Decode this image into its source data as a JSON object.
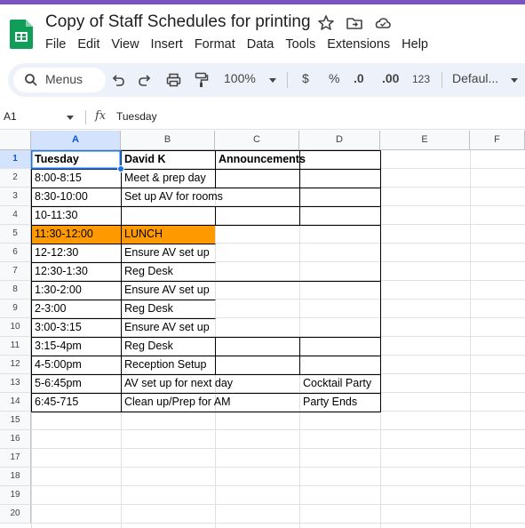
{
  "app": {
    "doc_title": "Copy of Staff Schedules for printing",
    "accent_color": "#7b53c1",
    "icons": [
      "sheets-logo",
      "star-icon",
      "move-folder-icon",
      "cloud-status-icon"
    ]
  },
  "menu": [
    "File",
    "Edit",
    "View",
    "Insert",
    "Format",
    "Data",
    "Tools",
    "Extensions",
    "Help"
  ],
  "toolbar": {
    "search_label": "Menus",
    "zoom": "100%",
    "currency": "$",
    "percent": "%",
    "dec_decrease": ".0",
    "dec_increase": ".00",
    "number_format": "123",
    "font": "Defaul..."
  },
  "formula_bar": {
    "name_box": "A1",
    "fx": "fx",
    "content": "Tuesday"
  },
  "grid": {
    "columns": [
      "A",
      "B",
      "C",
      "D",
      "E",
      "F"
    ],
    "selected_column": "A",
    "rows": [
      "1",
      "2",
      "3",
      "4",
      "5",
      "6",
      "7",
      "8",
      "9",
      "10",
      "11",
      "12",
      "13",
      "14",
      "15",
      "16",
      "17",
      "18",
      "19",
      "20"
    ],
    "selected_row": "1",
    "selected_cell": "A1",
    "lunch_highlight_color": "#ff9900",
    "cells": {
      "A1": "Tuesday",
      "B1": "David K",
      "C1": "Announcements",
      "A2": "8:00-8:15",
      "B2": "Meet & prep day",
      "A3": "8:30-10:00",
      "B3": "Set up AV for rooms",
      "A4": "10-11:30",
      "A5": "11:30-12:00",
      "B5": "LUNCH",
      "A6": "12-12:30",
      "B6": "Ensure AV set up",
      "A7": "12:30-1:30",
      "B7": "Reg Desk",
      "A8": "1:30-2:00",
      "B8": "Ensure AV set up",
      "A9": "2-3:00",
      "B9": "Reg Desk",
      "A10": "3:00-3:15",
      "B10": "Ensure AV set up",
      "A11": "3:15-4pm",
      "B11": "Reg Desk",
      "A12": "4-5:00pm",
      "B12": "Reception Setup",
      "A13": "5-6:45pm",
      "B13": "AV set up for next day",
      "D13": "Cocktail Party",
      "A14": "6:45-715",
      "B14": "Clean up/Prep for AM",
      "D14": "Party Ends"
    }
  }
}
